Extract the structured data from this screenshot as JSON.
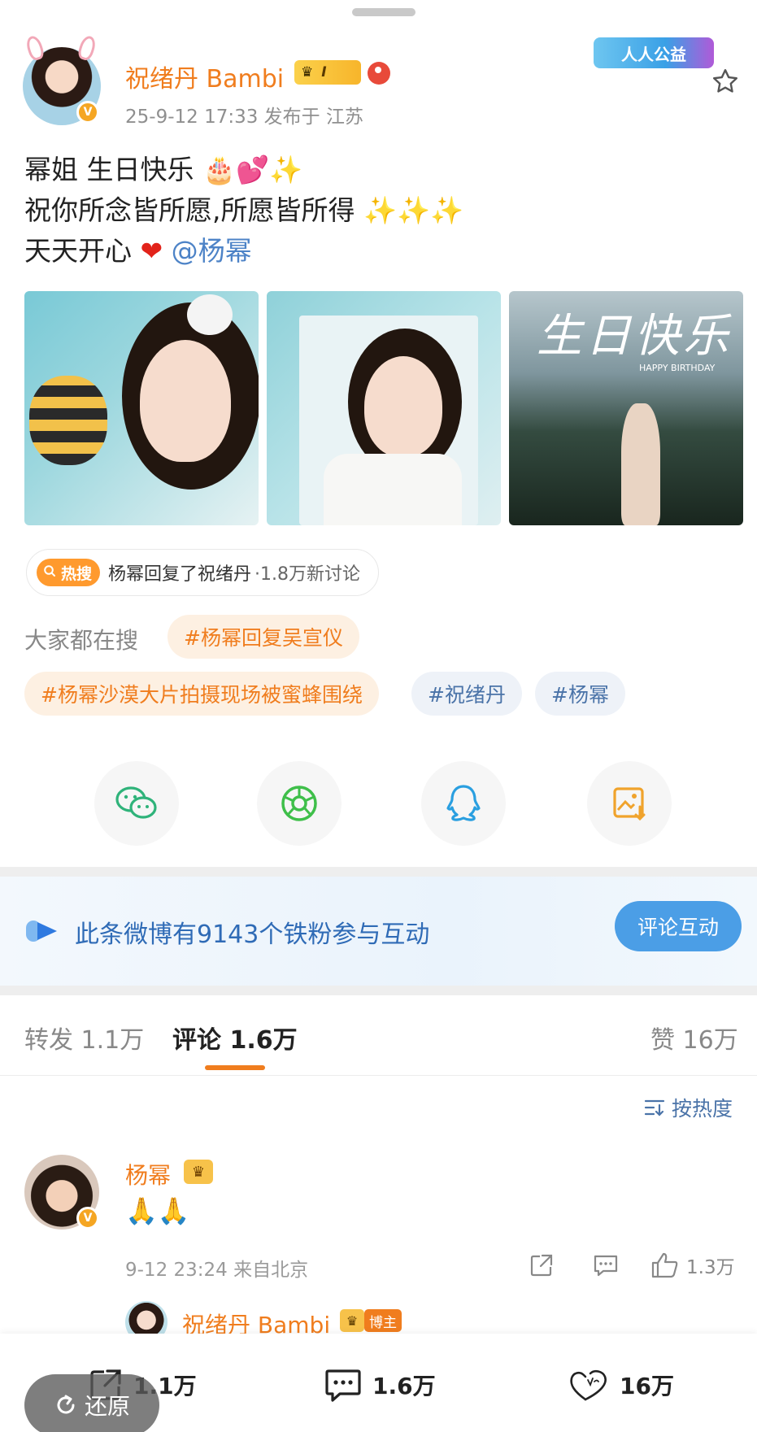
{
  "post": {
    "author": "祝绪丹 Bambi",
    "level_badge": "I",
    "meta": "25-9-12 17:33  发布于 江苏",
    "activity_badge": "人人公益",
    "text": {
      "line1": "幂姐 生日快乐",
      "line2": "祝你所念皆所愿,所愿皆所得",
      "line3": "天天开心",
      "mention": "@杨幂"
    },
    "image3_title": "生日快乐",
    "image3_caption": "HAPPY BIRTHDAY"
  },
  "hot_search": {
    "tag": "热搜",
    "title": "杨幂回复了祝绪丹",
    "count": "·1.8万新讨论"
  },
  "everyone_searching": {
    "label": "大家都在搜",
    "tags": [
      "#杨幂回复吴宣仪",
      "#杨幂沙漠大片拍摄现场被蜜蜂围绕",
      "#祝绪丹",
      "#杨幂"
    ]
  },
  "share": {
    "icons": [
      "wechat-icon",
      "moments-icon",
      "qq-icon",
      "save-image-icon"
    ]
  },
  "fans_banner": {
    "text": "此条微博有9143个铁粉参与互动",
    "button": "评论互动"
  },
  "tabs": {
    "repost": "转发 1.1万",
    "comments": "评论 1.6万",
    "likes": "赞 16万"
  },
  "sort_label": "按热度",
  "comment": {
    "author": "杨幂",
    "text": "🙏🙏",
    "meta": "9-12 23:24  来自北京",
    "like_count": "1.3万",
    "reply_author": "祝绪丹 Bambi",
    "reply_badge": "博主"
  },
  "bottom_bar": {
    "repost_count": "1.1万",
    "comment_count": "1.6万",
    "like_count": "16万"
  },
  "restore_label": "还原",
  "colors": {
    "accent_orange": "#f07d1e",
    "link_blue": "#4d83c7",
    "button_blue": "#4b9ee6"
  }
}
